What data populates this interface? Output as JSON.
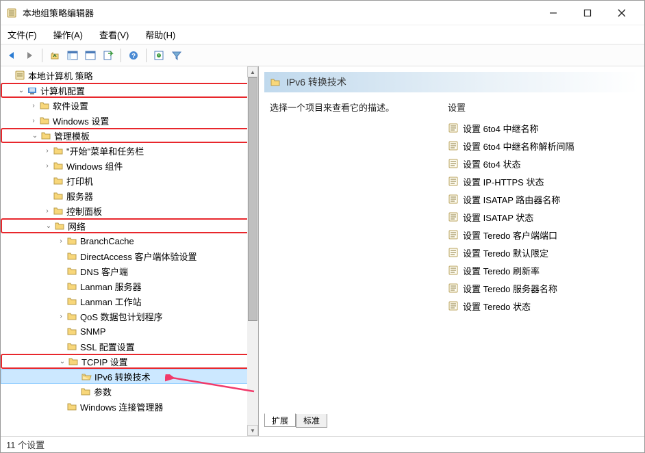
{
  "window": {
    "title": "本地组策略编辑器"
  },
  "menu": {
    "file": "文件(F)",
    "action": "操作(A)",
    "view": "查看(V)",
    "help": "帮助(H)"
  },
  "root": {
    "label": "本地计算机 策略"
  },
  "cfg": {
    "computer": "计算机配置",
    "software": "软件设置",
    "windows": "Windows 设置",
    "admin": "管理模板",
    "start": "\"开始\"菜单和任务栏",
    "wincomp": "Windows 组件",
    "printer": "打印机",
    "server": "服务器",
    "control": "控制面板",
    "network": "网络"
  },
  "net": {
    "branchcache": "BranchCache",
    "directaccess": "DirectAccess 客户端体验设置",
    "dns": "DNS 客户端",
    "lanmanserver": "Lanman 服务器",
    "lanmanws": "Lanman 工作站",
    "qos": "QoS 数据包计划程序",
    "snmp": "SNMP",
    "ssl": "SSL 配置设置",
    "tcpip": "TCPIP 设置",
    "ipv6": "IPv6 转换技术",
    "params": "参数",
    "wcm": "Windows 连接管理器"
  },
  "ipv6last": "Windows 连接管理器",
  "detail": {
    "header": "IPv6 转换技术",
    "desc": "选择一个项目来查看它的描述。",
    "settings_label": "设置",
    "items": [
      "设置 6to4 中继名称",
      "设置 6to4 中继名称解析间隔",
      "设置 6to4 状态",
      "设置 IP-HTTPS 状态",
      "设置 ISATAP 路由器名称",
      "设置 ISATAP 状态",
      "设置 Teredo 客户端端口",
      "设置 Teredo 默认限定",
      "设置 Teredo 刷新率",
      "设置 Teredo 服务器名称",
      "设置 Teredo 状态"
    ]
  },
  "tabs": {
    "extended": "扩展",
    "standard": "标准"
  },
  "status": "11 个设置"
}
